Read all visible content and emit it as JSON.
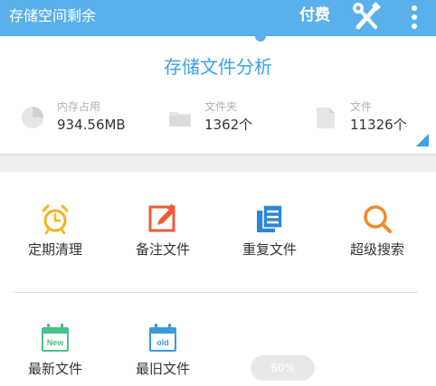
{
  "app": {
    "title": "存储空间剩余",
    "pay_label": "付费"
  },
  "analysis": {
    "title": "存储文件分析",
    "stats": [
      {
        "label": "内存占用",
        "value": "934.56MB",
        "icon": "pie-chart-icon"
      },
      {
        "label": "文件夹",
        "value": "1362个",
        "icon": "folder-icon"
      },
      {
        "label": "文件",
        "value": "11326个",
        "icon": "file-icon"
      }
    ]
  },
  "tools": [
    {
      "label": "定期清理",
      "icon": "alarm-clock-icon",
      "color": "#f5b31b"
    },
    {
      "label": "备注文件",
      "icon": "edit-note-icon",
      "color": "#ef5a3a"
    },
    {
      "label": "重复文件",
      "icon": "duplicate-files-icon",
      "color": "#2f86d8"
    },
    {
      "label": "超级搜索",
      "icon": "search-icon",
      "color": "#f08a2a"
    },
    {
      "label": "最新文件",
      "icon": "calendar-new-icon",
      "badge": "New",
      "color": "#4bc08a"
    },
    {
      "label": "最旧文件",
      "icon": "calendar-old-icon",
      "badge": "old",
      "color": "#3a9ae0"
    }
  ],
  "progress": {
    "text": "60%",
    "value": 0.6
  },
  "colors": {
    "header": "#5ab0ea",
    "accent": "#39a3e6"
  }
}
